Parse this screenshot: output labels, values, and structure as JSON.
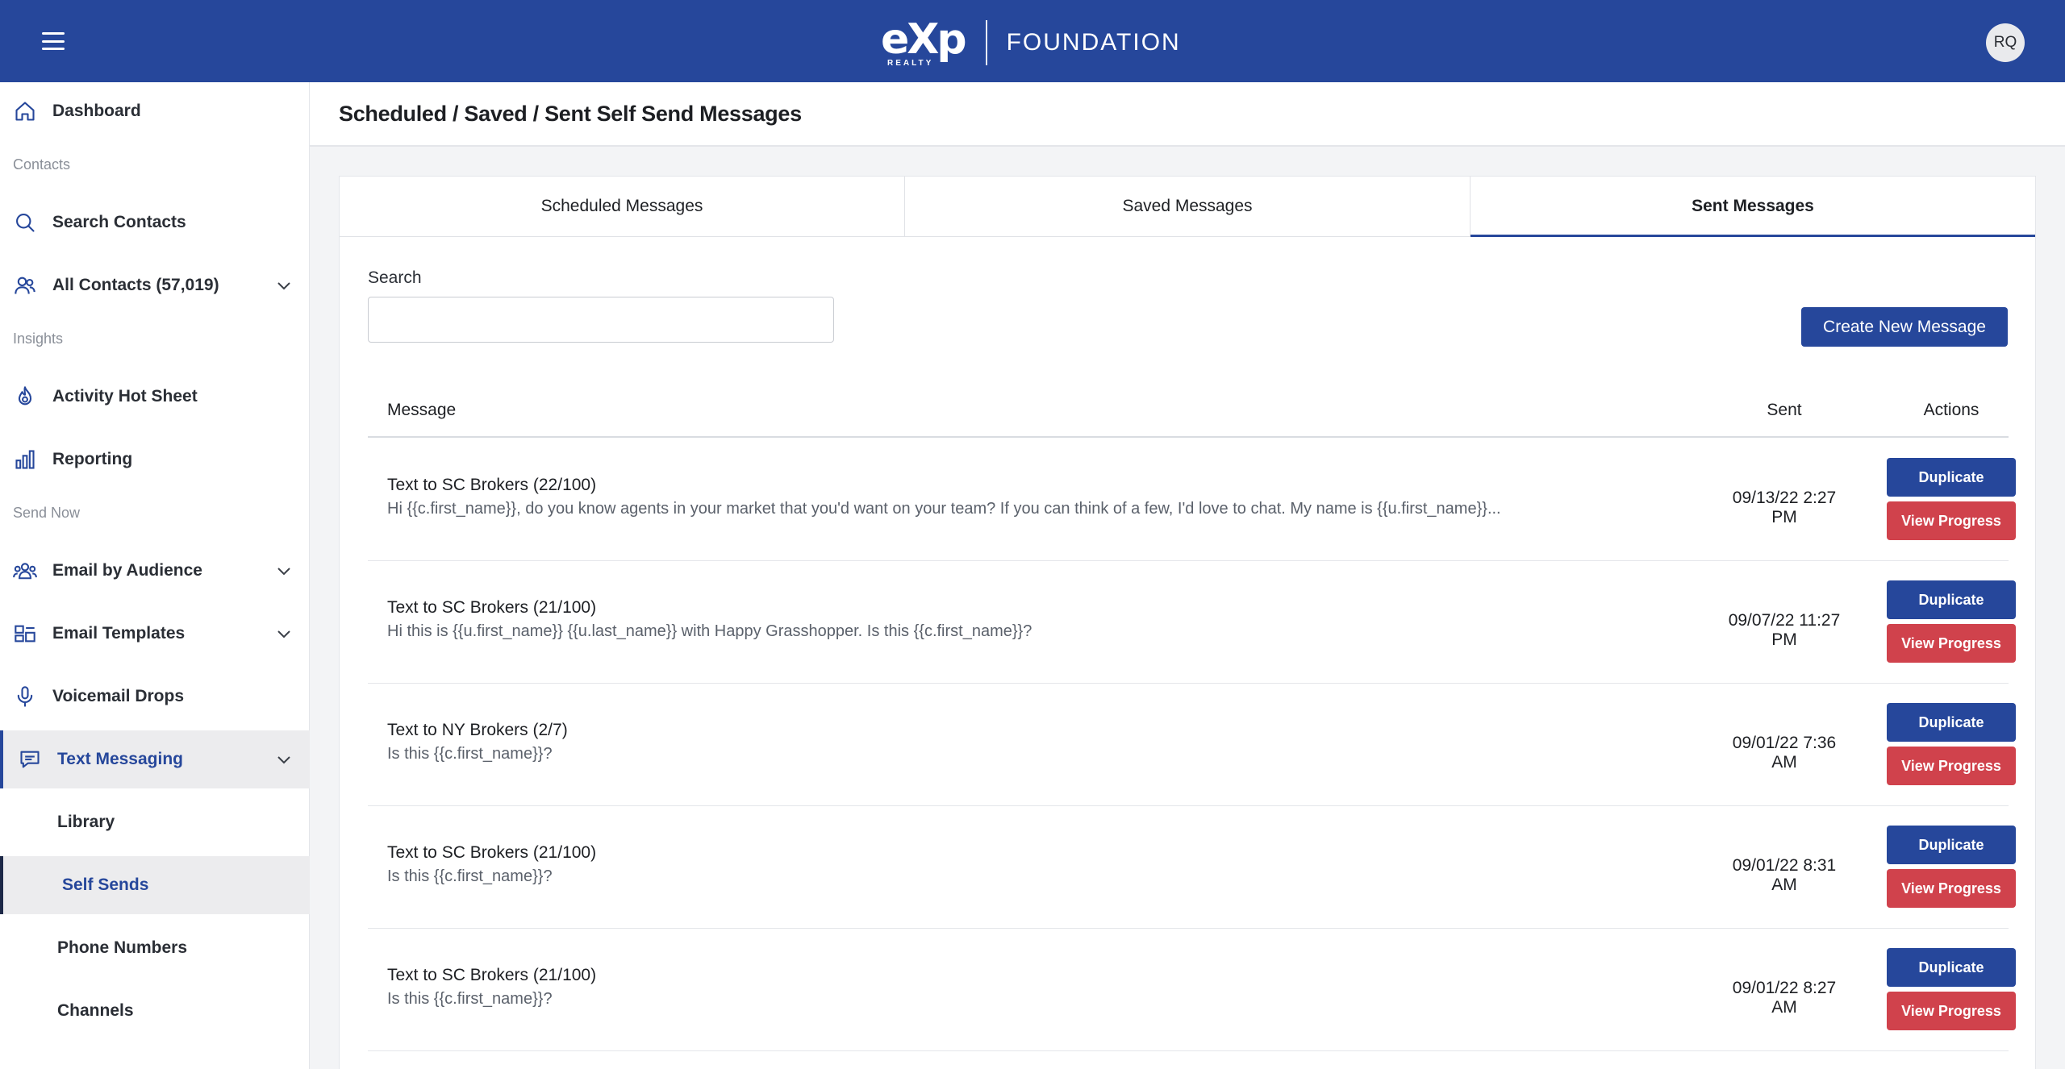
{
  "topbar": {
    "logo_mark": "eXp",
    "logo_sub": "REALTY",
    "logo_name": "FOUNDATION",
    "avatar_initials": "RQ",
    "menu_icon": "hamburger-icon"
  },
  "sidebar": {
    "dashboard": "Dashboard",
    "section_contacts": "Contacts",
    "search_contacts": "Search Contacts",
    "all_contacts": "All Contacts (57,019)",
    "section_insights": "Insights",
    "activity_hot_sheet": "Activity Hot Sheet",
    "reporting": "Reporting",
    "section_send_now": "Send Now",
    "email_by_audience": "Email by Audience",
    "email_templates": "Email Templates",
    "voicemail_drops": "Voicemail Drops",
    "text_messaging": "Text Messaging",
    "library": "Library",
    "self_sends": "Self Sends",
    "phone_numbers": "Phone Numbers",
    "channels": "Channels"
  },
  "header": {
    "title": "Scheduled / Saved / Sent Self Send Messages"
  },
  "tabs": {
    "scheduled": "Scheduled Messages",
    "saved": "Saved Messages",
    "sent": "Sent Messages",
    "active": "sent"
  },
  "search": {
    "label": "Search",
    "value": "",
    "placeholder": ""
  },
  "create_button": "Create New Message",
  "table": {
    "columns": {
      "message": "Message",
      "sent": "Sent",
      "actions": "Actions"
    },
    "duplicate_label": "Duplicate",
    "progress_label": "View Progress",
    "rows": [
      {
        "title": "Text to SC Brokers (22/100)",
        "body": "Hi {{c.first_name}}, do you know agents in your market that you'd want on your team? If you can think of a few, I'd love to chat. My name is {{u.first_name}}...",
        "sent": "09/13/22 2:27 PM"
      },
      {
        "title": "Text to SC Brokers (21/100)",
        "body": "Hi this is {{u.first_name}} {{u.last_name}} with Happy Grasshopper. Is this {{c.first_name}}?",
        "sent": "09/07/22 11:27 PM"
      },
      {
        "title": "Text to NY Brokers (2/7)",
        "body": "Is this {{c.first_name}}?",
        "sent": "09/01/22 7:36 AM"
      },
      {
        "title": "Text to SC Brokers (21/100)",
        "body": "Is this {{c.first_name}}?",
        "sent": "09/01/22 8:31 AM"
      },
      {
        "title": "Text to SC Brokers (21/100)",
        "body": "Is this {{c.first_name}}?",
        "sent": "09/01/22 8:27 AM"
      }
    ]
  },
  "colors": {
    "brand": "#26479b",
    "danger": "#d0424c"
  }
}
